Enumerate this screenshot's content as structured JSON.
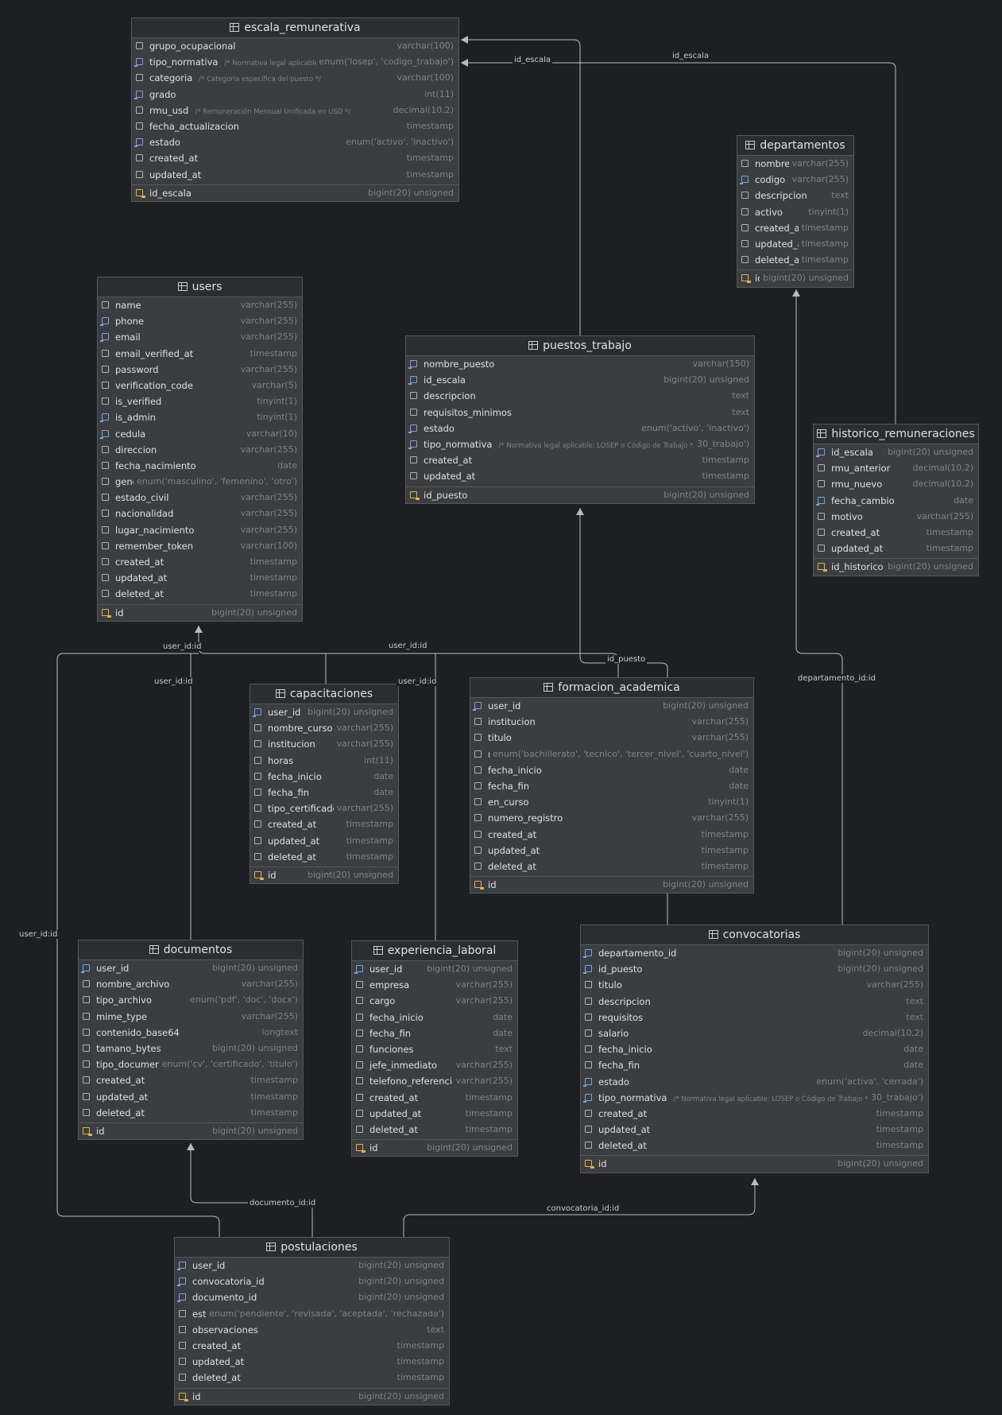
{
  "tables": [
    {
      "key": "escala_remunerativa",
      "name": "escala_remunerativa",
      "columns": [
        {
          "name": "grupo_ocupacional",
          "type": "varchar(100)",
          "icon": "column"
        },
        {
          "name": "tipo_normativa",
          "type": "enum('losep', 'codigo_trabajo')",
          "icon": "index",
          "comment": "/* Normativa legal aplicable */"
        },
        {
          "name": "categoria",
          "type": "varchar(100)",
          "icon": "column",
          "comment": "/* Categoría específica del puesto */"
        },
        {
          "name": "grado",
          "type": "int(11)",
          "icon": "index"
        },
        {
          "name": "rmu_usd",
          "type": "decimal(10,2)",
          "icon": "column",
          "comment": "/* Remuneración Mensual Unificada en USD */"
        },
        {
          "name": "fecha_actualizacion",
          "type": "timestamp",
          "icon": "column"
        },
        {
          "name": "estado",
          "type": "enum('activo', 'inactivo')",
          "icon": "index"
        },
        {
          "name": "created_at",
          "type": "timestamp",
          "icon": "column"
        },
        {
          "name": "updated_at",
          "type": "timestamp",
          "icon": "column"
        }
      ],
      "pk": {
        "name": "id_escala",
        "type": "bigint(20) unsigned"
      }
    },
    {
      "key": "departamentos",
      "name": "departamentos",
      "columns": [
        {
          "name": "nombre",
          "type": "varchar(255)",
          "icon": "column"
        },
        {
          "name": "codigo",
          "type": "varchar(255)",
          "icon": "index"
        },
        {
          "name": "descripcion",
          "type": "text",
          "icon": "column"
        },
        {
          "name": "activo",
          "type": "tinyint(1)",
          "icon": "column"
        },
        {
          "name": "created_at",
          "type": "timestamp",
          "icon": "column"
        },
        {
          "name": "updated_at",
          "type": "timestamp",
          "icon": "column"
        },
        {
          "name": "deleted_at",
          "type": "timestamp",
          "icon": "column"
        }
      ],
      "pk": {
        "name": "id",
        "type": "bigint(20) unsigned"
      }
    },
    {
      "key": "users",
      "name": "users",
      "columns": [
        {
          "name": "name",
          "type": "varchar(255)",
          "icon": "column"
        },
        {
          "name": "phone",
          "type": "varchar(255)",
          "icon": "index"
        },
        {
          "name": "email",
          "type": "varchar(255)",
          "icon": "index"
        },
        {
          "name": "email_verified_at",
          "type": "timestamp",
          "icon": "column"
        },
        {
          "name": "password",
          "type": "varchar(255)",
          "icon": "column"
        },
        {
          "name": "verification_code",
          "type": "varchar(5)",
          "icon": "column"
        },
        {
          "name": "is_verified",
          "type": "tinyint(1)",
          "icon": "column"
        },
        {
          "name": "is_admin",
          "type": "tinyint(1)",
          "icon": "index"
        },
        {
          "name": "cedula",
          "type": "varchar(10)",
          "icon": "index"
        },
        {
          "name": "direccion",
          "type": "varchar(255)",
          "icon": "column"
        },
        {
          "name": "fecha_nacimiento",
          "type": "date",
          "icon": "column"
        },
        {
          "name": "genero",
          "type": "enum('masculino', 'femenino', 'otro')",
          "icon": "column"
        },
        {
          "name": "estado_civil",
          "type": "varchar(255)",
          "icon": "column"
        },
        {
          "name": "nacionalidad",
          "type": "varchar(255)",
          "icon": "column"
        },
        {
          "name": "lugar_nacimiento",
          "type": "varchar(255)",
          "icon": "column"
        },
        {
          "name": "remember_token",
          "type": "varchar(100)",
          "icon": "column"
        },
        {
          "name": "created_at",
          "type": "timestamp",
          "icon": "column"
        },
        {
          "name": "updated_at",
          "type": "timestamp",
          "icon": "column"
        },
        {
          "name": "deleted_at",
          "type": "timestamp",
          "icon": "column"
        }
      ],
      "pk": {
        "name": "id",
        "type": "bigint(20) unsigned"
      }
    },
    {
      "key": "puestos_trabajo",
      "name": "puestos_trabajo",
      "columns": [
        {
          "name": "nombre_puesto",
          "type": "varchar(150)",
          "icon": "index"
        },
        {
          "name": "id_escala",
          "type": "bigint(20) unsigned",
          "icon": "index"
        },
        {
          "name": "descripcion",
          "type": "text",
          "icon": "column"
        },
        {
          "name": "requisitos_minimos",
          "type": "text",
          "icon": "column"
        },
        {
          "name": "estado",
          "type": "enum('activo', 'inactivo')",
          "icon": "index"
        },
        {
          "name": "tipo_normativa",
          "type": "30_trabajo')",
          "icon": "index",
          "comment": "/* Normativa legal aplicable: LOSEP o Código de Trabajo */"
        },
        {
          "name": "created_at",
          "type": "timestamp",
          "icon": "column"
        },
        {
          "name": "updated_at",
          "type": "timestamp",
          "icon": "column"
        }
      ],
      "pk": {
        "name": "id_puesto",
        "type": "bigint(20) unsigned"
      }
    },
    {
      "key": "historico_remuneraciones",
      "name": "historico_remuneraciones",
      "columns": [
        {
          "name": "id_escala",
          "type": "bigint(20) unsigned",
          "icon": "index"
        },
        {
          "name": "rmu_anterior",
          "type": "decimal(10,2)",
          "icon": "column"
        },
        {
          "name": "rmu_nuevo",
          "type": "decimal(10,2)",
          "icon": "column"
        },
        {
          "name": "fecha_cambio",
          "type": "date",
          "icon": "index"
        },
        {
          "name": "motivo",
          "type": "varchar(255)",
          "icon": "column"
        },
        {
          "name": "created_at",
          "type": "timestamp",
          "icon": "column"
        },
        {
          "name": "updated_at",
          "type": "timestamp",
          "icon": "column"
        }
      ],
      "pk": {
        "name": "id_historico",
        "type": "bigint(20) unsigned"
      }
    },
    {
      "key": "capacitaciones",
      "name": "capacitaciones",
      "columns": [
        {
          "name": "user_id",
          "type": "bigint(20) unsigned",
          "icon": "index"
        },
        {
          "name": "nombre_curso",
          "type": "varchar(255)",
          "icon": "column"
        },
        {
          "name": "institucion",
          "type": "varchar(255)",
          "icon": "column"
        },
        {
          "name": "horas",
          "type": "int(11)",
          "icon": "column"
        },
        {
          "name": "fecha_inicio",
          "type": "date",
          "icon": "column"
        },
        {
          "name": "fecha_fin",
          "type": "date",
          "icon": "column"
        },
        {
          "name": "tipo_certificado",
          "type": "varchar(255)",
          "icon": "column"
        },
        {
          "name": "created_at",
          "type": "timestamp",
          "icon": "column"
        },
        {
          "name": "updated_at",
          "type": "timestamp",
          "icon": "column"
        },
        {
          "name": "deleted_at",
          "type": "timestamp",
          "icon": "column"
        }
      ],
      "pk": {
        "name": "id",
        "type": "bigint(20) unsigned"
      }
    },
    {
      "key": "formacion_academica",
      "name": "formacion_academica",
      "columns": [
        {
          "name": "user_id",
          "type": "bigint(20) unsigned",
          "icon": "index"
        },
        {
          "name": "institucion",
          "type": "varchar(255)",
          "icon": "column"
        },
        {
          "name": "titulo",
          "type": "varchar(255)",
          "icon": "column"
        },
        {
          "name": "nivel",
          "type": "enum('bachillerato', 'tecnico', 'tercer_nivel', 'cuarto_nivel')",
          "icon": "column"
        },
        {
          "name": "fecha_inicio",
          "type": "date",
          "icon": "column"
        },
        {
          "name": "fecha_fin",
          "type": "date",
          "icon": "column"
        },
        {
          "name": "en_curso",
          "type": "tinyint(1)",
          "icon": "column"
        },
        {
          "name": "numero_registro",
          "type": "varchar(255)",
          "icon": "column"
        },
        {
          "name": "created_at",
          "type": "timestamp",
          "icon": "column"
        },
        {
          "name": "updated_at",
          "type": "timestamp",
          "icon": "column"
        },
        {
          "name": "deleted_at",
          "type": "timestamp",
          "icon": "column"
        }
      ],
      "pk": {
        "name": "id",
        "type": "bigint(20) unsigned"
      }
    },
    {
      "key": "documentos",
      "name": "documentos",
      "columns": [
        {
          "name": "user_id",
          "type": "bigint(20) unsigned",
          "icon": "index"
        },
        {
          "name": "nombre_archivo",
          "type": "varchar(255)",
          "icon": "column"
        },
        {
          "name": "tipo_archivo",
          "type": "enum('pdf', 'doc', 'docx')",
          "icon": "column"
        },
        {
          "name": "mime_type",
          "type": "varchar(255)",
          "icon": "column"
        },
        {
          "name": "contenido_base64",
          "type": "longtext",
          "icon": "column"
        },
        {
          "name": "tamano_bytes",
          "type": "bigint(20) unsigned",
          "icon": "column"
        },
        {
          "name": "tipo_documento",
          "type": "enum('cv', 'certificado', 'titulo')",
          "icon": "column"
        },
        {
          "name": "created_at",
          "type": "timestamp",
          "icon": "column"
        },
        {
          "name": "updated_at",
          "type": "timestamp",
          "icon": "column"
        },
        {
          "name": "deleted_at",
          "type": "timestamp",
          "icon": "column"
        }
      ],
      "pk": {
        "name": "id",
        "type": "bigint(20) unsigned"
      }
    },
    {
      "key": "experiencia_laboral",
      "name": "experiencia_laboral",
      "columns": [
        {
          "name": "user_id",
          "type": "bigint(20) unsigned",
          "icon": "index"
        },
        {
          "name": "empresa",
          "type": "varchar(255)",
          "icon": "column"
        },
        {
          "name": "cargo",
          "type": "varchar(255)",
          "icon": "column"
        },
        {
          "name": "fecha_inicio",
          "type": "date",
          "icon": "column"
        },
        {
          "name": "fecha_fin",
          "type": "date",
          "icon": "column"
        },
        {
          "name": "funciones",
          "type": "text",
          "icon": "column"
        },
        {
          "name": "jefe_inmediato",
          "type": "varchar(255)",
          "icon": "column"
        },
        {
          "name": "telefono_referencia",
          "type": "varchar(255)",
          "icon": "column"
        },
        {
          "name": "created_at",
          "type": "timestamp",
          "icon": "column"
        },
        {
          "name": "updated_at",
          "type": "timestamp",
          "icon": "column"
        },
        {
          "name": "deleted_at",
          "type": "timestamp",
          "icon": "column"
        }
      ],
      "pk": {
        "name": "id",
        "type": "bigint(20) unsigned"
      }
    },
    {
      "key": "convocatorias",
      "name": "convocatorias",
      "columns": [
        {
          "name": "departamento_id",
          "type": "bigint(20) unsigned",
          "icon": "index"
        },
        {
          "name": "id_puesto",
          "type": "bigint(20) unsigned",
          "icon": "index"
        },
        {
          "name": "titulo",
          "type": "varchar(255)",
          "icon": "column"
        },
        {
          "name": "descripcion",
          "type": "text",
          "icon": "column"
        },
        {
          "name": "requisitos",
          "type": "text",
          "icon": "column"
        },
        {
          "name": "salario",
          "type": "decimal(10,2)",
          "icon": "column"
        },
        {
          "name": "fecha_inicio",
          "type": "date",
          "icon": "column"
        },
        {
          "name": "fecha_fin",
          "type": "date",
          "icon": "column"
        },
        {
          "name": "estado",
          "type": "enum('activa', 'cerrada')",
          "icon": "index"
        },
        {
          "name": "tipo_normativa",
          "type": "30_trabajo')",
          "icon": "index",
          "comment": "/* Normativa legal aplicable: LOSEP o Código de Trabajo */"
        },
        {
          "name": "created_at",
          "type": "timestamp",
          "icon": "column"
        },
        {
          "name": "updated_at",
          "type": "timestamp",
          "icon": "column"
        },
        {
          "name": "deleted_at",
          "type": "timestamp",
          "icon": "column"
        }
      ],
      "pk": {
        "name": "id",
        "type": "bigint(20) unsigned"
      }
    },
    {
      "key": "postulaciones",
      "name": "postulaciones",
      "columns": [
        {
          "name": "user_id",
          "type": "bigint(20) unsigned",
          "icon": "index"
        },
        {
          "name": "convocatoria_id",
          "type": "bigint(20) unsigned",
          "icon": "index"
        },
        {
          "name": "documento_id",
          "type": "bigint(20) unsigned",
          "icon": "index"
        },
        {
          "name": "estado",
          "type": "enum('pendiente', 'revisada', 'aceptada', 'rechazada')",
          "icon": "column"
        },
        {
          "name": "observaciones",
          "type": "text",
          "icon": "column"
        },
        {
          "name": "created_at",
          "type": "timestamp",
          "icon": "column"
        },
        {
          "name": "updated_at",
          "type": "timestamp",
          "icon": "column"
        },
        {
          "name": "deleted_at",
          "type": "timestamp",
          "icon": "column"
        }
      ],
      "pk": {
        "name": "id",
        "type": "bigint(20) unsigned"
      }
    }
  ],
  "edge_labels": {
    "puestos_escala": "id_escala",
    "historico_escala": "id_escala",
    "users_main": "user_id:id",
    "users_left": "user_id:id",
    "users_docs": "user_id:id",
    "users_mid": "user_id:id",
    "users_exp": "user_id:id",
    "puesto_link": "id_puesto",
    "departamento_link": "departamento_id:id",
    "documento_link": "documento_id:id",
    "convocatoria_link": "convocatoria_id:id"
  },
  "colors": {
    "background": "#1e1f22",
    "table": "#3b3d40",
    "header": "#2b2d30",
    "edge": "#b8bbc0",
    "index_icon": "#7aa3e5",
    "pk_icon": "#e0b34f"
  }
}
